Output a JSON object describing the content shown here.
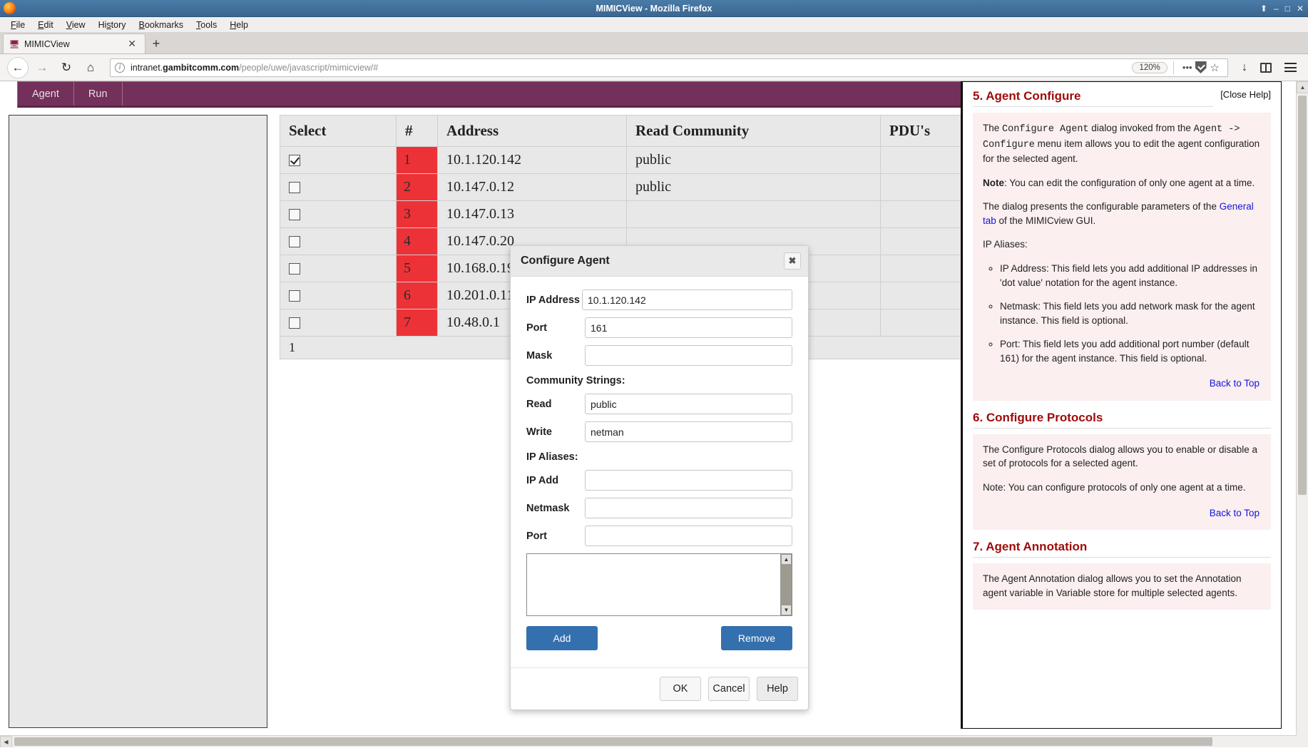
{
  "window": {
    "title": "MIMICView - Mozilla Firefox",
    "controls": {
      "minimize": "–",
      "maximize": "□",
      "close": "✕",
      "pin": "⬆"
    }
  },
  "menubar": {
    "items": [
      "File",
      "Edit",
      "View",
      "History",
      "Bookmarks",
      "Tools",
      "Help"
    ]
  },
  "tabs": {
    "items": [
      {
        "label": "MIMICView",
        "favicon": "mimic-icon",
        "close": "✕"
      }
    ],
    "new_tab": "+"
  },
  "nav": {
    "back": "←",
    "forward": "→",
    "reload": "↻",
    "home": "⌂",
    "url_host": "intranet.",
    "url_host_bold": "gambitcomm.com",
    "url_path": "/people/uwe/javascript/mimicview/#",
    "zoom": "120%",
    "page_actions": "•••",
    "download": "↓",
    "menu": "menu"
  },
  "app": {
    "toolbar": {
      "menus": [
        "Agent",
        "Run"
      ]
    },
    "table": {
      "headers": [
        "Select",
        "#",
        "Address",
        "Read Community",
        "PDU's"
      ],
      "rows": [
        {
          "selected": true,
          "num": "1",
          "address": "10.1.120.142",
          "read_community": "public",
          "pdus": ""
        },
        {
          "selected": false,
          "num": "2",
          "address": "10.147.0.12",
          "read_community": "public",
          "pdus": ""
        },
        {
          "selected": false,
          "num": "3",
          "address": "10.147.0.13",
          "read_community": "",
          "pdus": ""
        },
        {
          "selected": false,
          "num": "4",
          "address": "10.147.0.20",
          "read_community": "",
          "pdus": ""
        },
        {
          "selected": false,
          "num": "5",
          "address": "10.168.0.19",
          "read_community": "",
          "pdus": ""
        },
        {
          "selected": false,
          "num": "6",
          "address": "10.201.0.110",
          "read_community": "",
          "pdus": ""
        },
        {
          "selected": false,
          "num": "7",
          "address": "10.48.0.1",
          "read_community": "",
          "pdus": ""
        }
      ],
      "pager": "1"
    }
  },
  "dialog": {
    "title": "Configure Agent",
    "close": "✖",
    "fields": {
      "ip_address_label": "IP Address",
      "ip_address_value": "10.1.120.142",
      "port_label": "Port",
      "port_value": "161",
      "mask_label": "Mask",
      "mask_value": "",
      "community_heading": "Community Strings:",
      "read_label": "Read",
      "read_value": "public",
      "write_label": "Write",
      "write_value": "netman",
      "aliases_heading": "IP Aliases:",
      "ipadd_label": "IP Add",
      "ipadd_value": "",
      "netmask_label": "Netmask",
      "netmask_value": "",
      "alias_port_label": "Port",
      "alias_port_value": ""
    },
    "buttons": {
      "add": "Add",
      "remove": "Remove",
      "ok": "OK",
      "cancel": "Cancel",
      "help": "Help"
    }
  },
  "help": {
    "close_help": "[Close Help]",
    "sections": [
      {
        "heading": "5. Agent Configure",
        "paragraphs": [
          {
            "parts": [
              {
                "t": "The ",
                "style": "normal"
              },
              {
                "t": "Configure Agent",
                "style": "mono"
              },
              {
                "t": " dialog invoked from the ",
                "style": "normal"
              },
              {
                "t": "Agent -> Configure",
                "style": "mono"
              },
              {
                "t": " menu item allows you to edit the agent configuration for the selected agent.",
                "style": "normal"
              }
            ]
          },
          {
            "parts": [
              {
                "t": "Note",
                "style": "bold"
              },
              {
                "t": ": You can edit the configuration of only one agent at a time.",
                "style": "normal"
              }
            ]
          },
          {
            "parts": [
              {
                "t": "The dialog presents the configurable parameters of the ",
                "style": "normal"
              },
              {
                "t": "General tab",
                "style": "link"
              },
              {
                "t": " of the MIMICview GUI.",
                "style": "normal"
              }
            ]
          },
          {
            "parts": [
              {
                "t": "IP Aliases:",
                "style": "normal"
              }
            ]
          }
        ],
        "bullets": [
          "IP Address: This field lets you add additional IP addresses in 'dot value' notation for the agent instance.",
          "Netmask: This field lets you add network mask for the agent instance. This field is optional.",
          "Port: This field lets you add additional port number (default 161) for the agent instance. This field is optional."
        ],
        "back_to_top": "Back to Top"
      },
      {
        "heading": "6. Configure Protocols",
        "paragraphs": [
          {
            "parts": [
              {
                "t": "The Configure Protocols dialog allows you to enable or disable a set of protocols for a selected agent.",
                "style": "normal"
              }
            ]
          },
          {
            "parts": [
              {
                "t": "Note: You can configure protocols of only one agent at a time.",
                "style": "normal"
              }
            ]
          }
        ],
        "bullets": [],
        "back_to_top": "Back to Top"
      },
      {
        "heading": "7. Agent Annotation",
        "paragraphs": [
          {
            "parts": [
              {
                "t": "The Agent Annotation dialog allows you to set the Annotation agent variable in Variable store for multiple selected agents.",
                "style": "normal"
              }
            ]
          }
        ],
        "bullets": [],
        "back_to_top": ""
      }
    ]
  },
  "colors": {
    "accent_purple": "#72305a",
    "row_number_red": "#ed3237",
    "button_blue": "#3570ae",
    "help_heading_red": "#9e0a0a",
    "link_blue": "#1414e0"
  }
}
